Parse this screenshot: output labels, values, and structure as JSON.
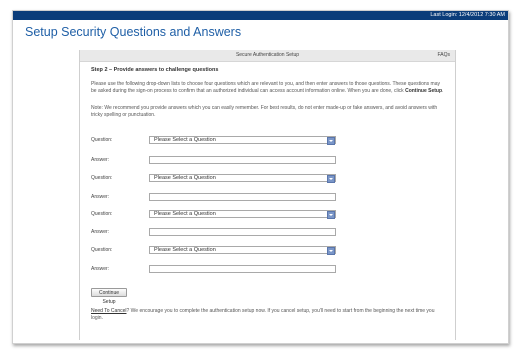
{
  "top_bar": {
    "last_login": "Last Login: 12/4/2012 7:30 AM"
  },
  "page": {
    "title": "Setup Security Questions and Answers"
  },
  "section": {
    "header": "Secure Authentication Setup",
    "faq_link": "FAQs"
  },
  "step": {
    "heading": "Step 2 – Provide answers to challenge questions"
  },
  "instructions": {
    "text_before": "Please use the following drop-down lists to choose four questions which are relevant to you, and then enter answers to those questions. These questions may be asked during the sign-on process to confirm that an authorized individual can access account information online. When you are done, click ",
    "emphasis": "Continue Setup",
    "text_after": "."
  },
  "note": {
    "text": "Note: We recommend you provide answers which you can easily remember. For best results, do not enter made-up or fake answers, and avoid answers with tricky spelling or punctuation."
  },
  "form": {
    "question_label": "Question:",
    "answer_label": "Answer:",
    "questions": [
      {
        "selected": "Please Select a Question",
        "answer": ""
      },
      {
        "selected": "Please Select a Question",
        "answer": ""
      },
      {
        "selected": "Please Select a Question",
        "answer": ""
      },
      {
        "selected": "Please Select a Question",
        "answer": ""
      }
    ]
  },
  "buttons": {
    "continue_label": "Continue Setup"
  },
  "cancel_note": {
    "link_text": "Need To Cancel",
    "text": "? We encourage you to complete the authentication setup now. If you cancel setup, you'll need to start from the beginning the next time you login."
  },
  "colors": {
    "top_bar": "#0b3d7a",
    "title": "#1f5fa6",
    "select_arrow": "#7a96c8"
  }
}
